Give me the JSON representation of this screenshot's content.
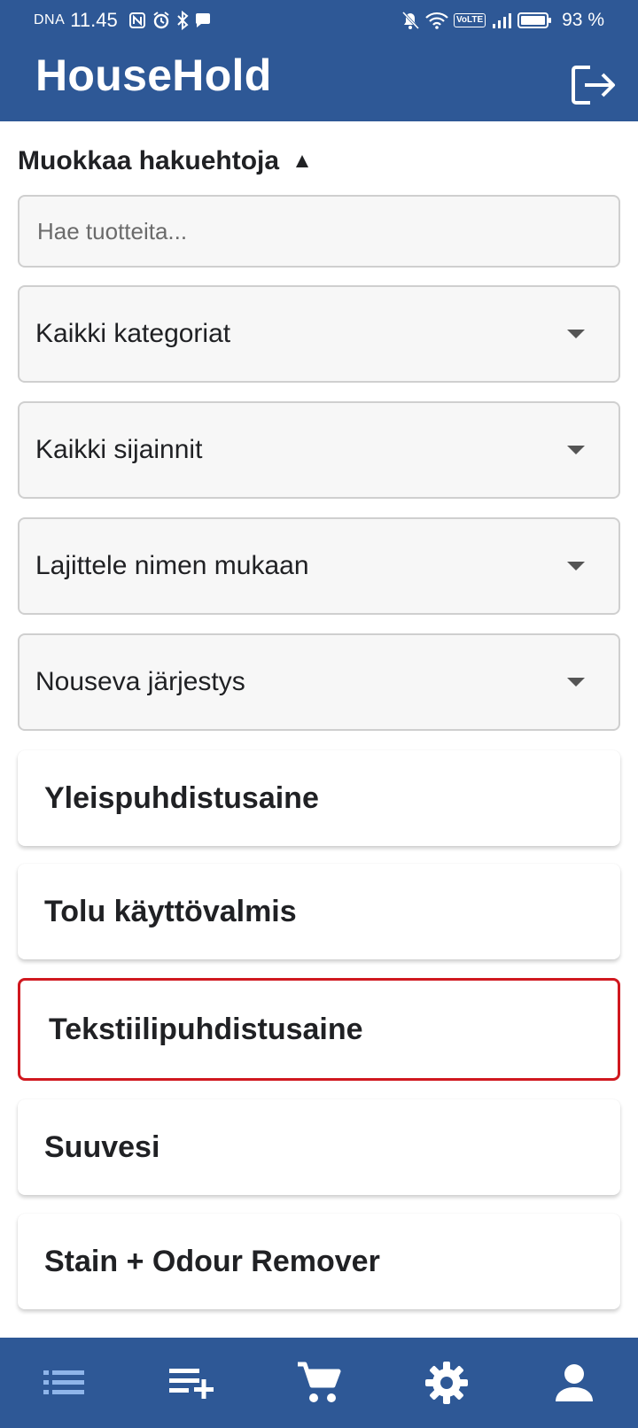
{
  "status_bar": {
    "carrier": "DNA",
    "time": "11.45",
    "volte": "VoLTE",
    "battery_percent": "93 %"
  },
  "header": {
    "title": "HouseHold",
    "logout_icon": "logout-icon"
  },
  "filters": {
    "toggle_label": "Muokkaa hakuehtoja",
    "toggle_symbol": "▲",
    "search_placeholder": "Hae tuotteita...",
    "category": "Kaikki kategoriat",
    "location": "Kaikki sijainnit",
    "sort_by": "Lajittele nimen mukaan",
    "sort_order": "Nouseva järjestys"
  },
  "products": [
    {
      "name": "Yleispuhdistusaine",
      "selected": false
    },
    {
      "name": "Tolu käyttövalmis",
      "selected": false
    },
    {
      "name": "Tekstiilipuhdistusaine",
      "selected": true
    },
    {
      "name": "Suuvesi",
      "selected": false
    },
    {
      "name": "Stain + Odour Remover",
      "selected": false
    }
  ],
  "bottom_nav": {
    "items": [
      "list-icon",
      "playlist-add-icon",
      "cart-icon",
      "gear-icon",
      "user-icon"
    ],
    "active_index": 0
  },
  "colors": {
    "primary": "#2e5896",
    "selected_border": "#d0181f",
    "active_nav_icon": "#8fb5ea"
  }
}
